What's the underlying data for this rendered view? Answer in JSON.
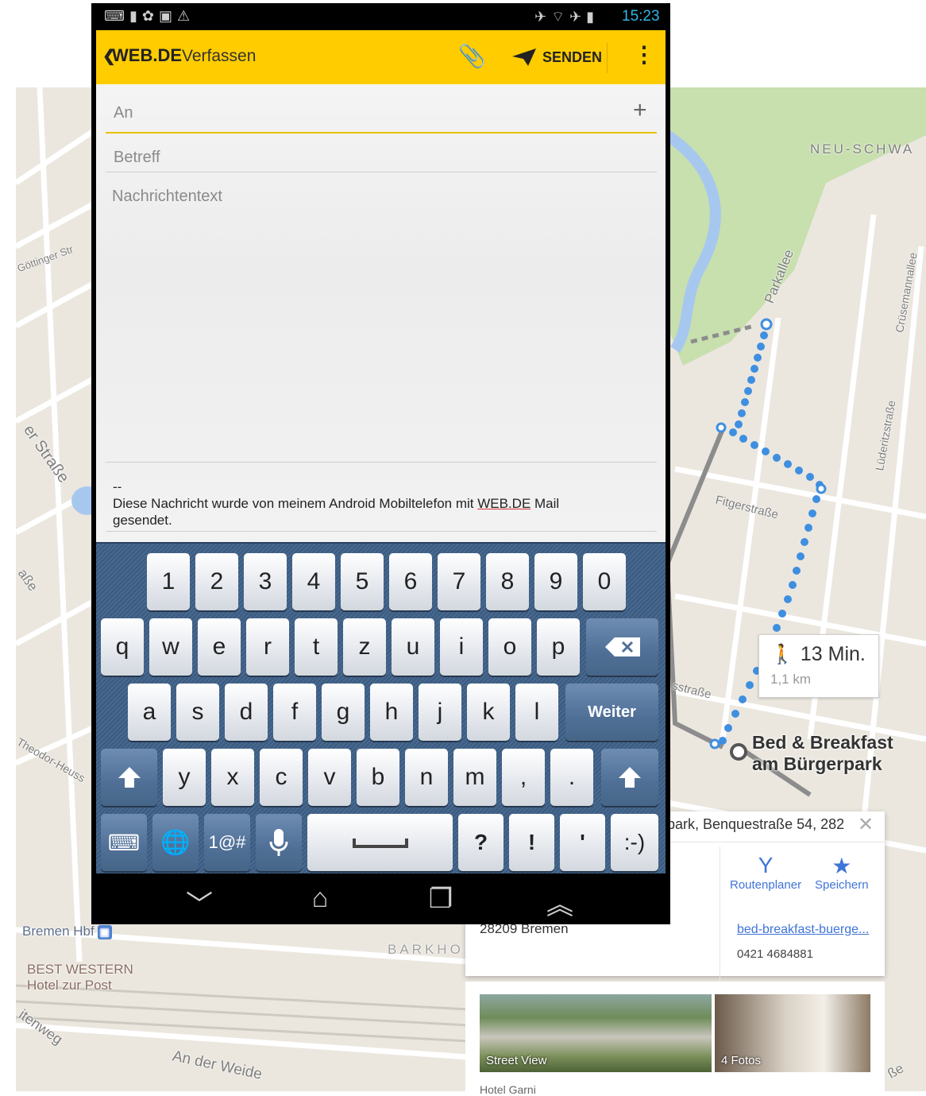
{
  "map": {
    "labels": {
      "neu_schwachhausen": "NEU-SCHWA",
      "parkallee": "Parkallee",
      "cruesemannallee": "Crüsemannallee",
      "luederitzstrasse": "Lüderitzstraße",
      "fitgerstrasse": "Fitgerstraße",
      "goettinger": "Göttinger Str",
      "er_strasse": "er Straße",
      "asse": "aße",
      "theodor_heuss": "Theodor-Heuss",
      "sstrasse": "sstraße",
      "bremen_hbf": "Bremen Hbf",
      "barkhof": "BARKHO",
      "best_western_1": "BEST WESTERN",
      "best_western_2": "Hotel zur Post",
      "leitenweg": "itenweg",
      "an_der_weide": "An der Weide",
      "se": "ße"
    },
    "walk": {
      "time": "13 Min.",
      "distance": "1,1 km"
    },
    "destination": {
      "line1": "Bed & Breakfast",
      "line2": "am Bürgerpark"
    },
    "card": {
      "address": "park, Benquestraße 54, 282",
      "routenplaner": "Routenplaner",
      "speichern": "Speichern",
      "city": "28209 Bremen",
      "website": "bed-breakfast-buerge...",
      "phone": "0421 4684881",
      "streetview": "Street View",
      "fotos": "4 Fotos",
      "hotel_garni": "Hotel Garni"
    }
  },
  "phone": {
    "status_time": "15:23",
    "appbar": {
      "brand": "WEB.DE",
      "title": "Verfassen",
      "send_label": "SENDEN"
    },
    "form": {
      "to_placeholder": "An",
      "subject_placeholder": "Betreff",
      "body_placeholder": "Nachrichtentext",
      "sig_dashes": "--",
      "sig_prefix": "Diese Nachricht wurde von meinem Android Mobiltelefon mit ",
      "sig_link": "WEB.DE",
      "sig_suffix": " Mail",
      "sig_line2": "gesendet."
    },
    "keyboard": {
      "row_numbers": [
        "1",
        "2",
        "3",
        "4",
        "5",
        "6",
        "7",
        "8",
        "9",
        "0"
      ],
      "row_top": [
        "q",
        "w",
        "e",
        "r",
        "t",
        "z",
        "u",
        "i",
        "o",
        "p"
      ],
      "row_mid": [
        "a",
        "s",
        "d",
        "f",
        "g",
        "h",
        "j",
        "k",
        "l"
      ],
      "row_bottom": [
        "y",
        "x",
        "c",
        "v",
        "b",
        "n",
        "m",
        ",",
        "."
      ],
      "weiter": "Weiter",
      "sym": "1@#",
      "question": "?",
      "exclaim": "!",
      "apostrophe": "'",
      "smiley": ":-)"
    }
  },
  "colors": {
    "appbar": "#ffcc00",
    "accent_underline": "#e8c100",
    "route_blue": "#3f8fe0",
    "status_time": "#33b5e5"
  }
}
